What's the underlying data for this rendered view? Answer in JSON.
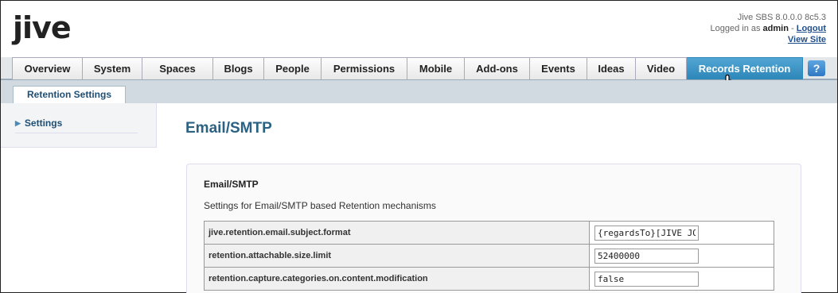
{
  "header": {
    "logo": "jive",
    "version": "Jive SBS 8.0.0.0 8c5.3",
    "logged_in_prefix": "Logged in as",
    "username": "admin",
    "separator": " - ",
    "logout": "Logout",
    "view_site": "View Site"
  },
  "nav": {
    "tabs": [
      {
        "label": "Overview"
      },
      {
        "label": "System"
      },
      {
        "label": "Spaces"
      },
      {
        "label": "Blogs"
      },
      {
        "label": "People"
      },
      {
        "label": "Permissions"
      },
      {
        "label": "Mobile"
      },
      {
        "label": "Add-ons"
      },
      {
        "label": "Events"
      },
      {
        "label": "Ideas"
      },
      {
        "label": "Video"
      },
      {
        "label": "Records Retention",
        "active": true
      }
    ],
    "help": "?"
  },
  "subnav": {
    "tab": "Retention Settings"
  },
  "sidebar": {
    "items": [
      {
        "label": "Settings"
      }
    ]
  },
  "main": {
    "title": "Email/SMTP",
    "panel": {
      "title": "Email/SMTP",
      "description": "Settings for Email/SMTP based Retention mechanisms",
      "rows": [
        {
          "key": "jive.retention.email.subject.format",
          "value": "{regardsTo}[JIVE JOURNAL]"
        },
        {
          "key": "retention.attachable.size.limit",
          "value": "52400000"
        },
        {
          "key": "retention.capture.categories.on.content.modification",
          "value": "false"
        }
      ]
    }
  },
  "colors": {
    "active_tab": "#3a96c8",
    "link": "#1f4e8c",
    "title": "#2b6283"
  }
}
